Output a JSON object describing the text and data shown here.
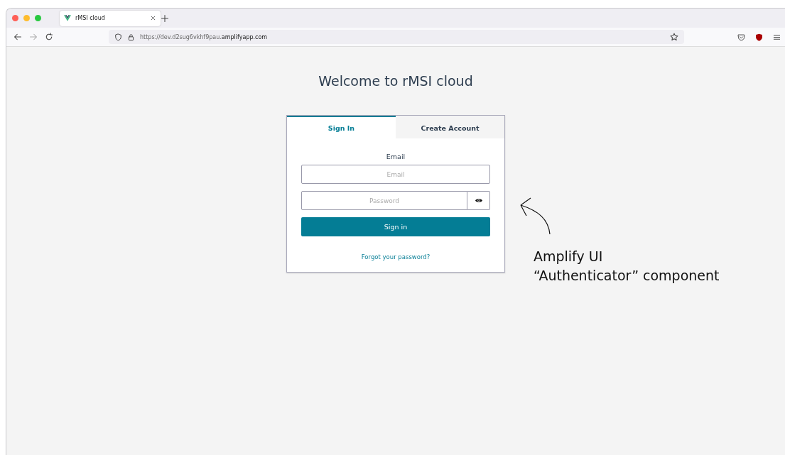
{
  "browser": {
    "tab": {
      "title": "rMSI cloud"
    },
    "url": {
      "prefix": "https://dev.d2sug6vkhf9pau.",
      "domain": "amplifyapp.com"
    }
  },
  "page": {
    "heading": "Welcome to rMSI cloud"
  },
  "auth": {
    "tabs": [
      {
        "label": "Sign In",
        "selected": true
      },
      {
        "label": "Create Account",
        "selected": false
      }
    ],
    "email_label": "Email",
    "email": {
      "placeholder": "Email"
    },
    "password": {
      "placeholder": "Password"
    },
    "submit": "Sign in",
    "forgot": "Forgot your password?"
  },
  "annotation": {
    "lines": [
      "Amplify UI",
      "“Authenticator” component"
    ]
  }
}
